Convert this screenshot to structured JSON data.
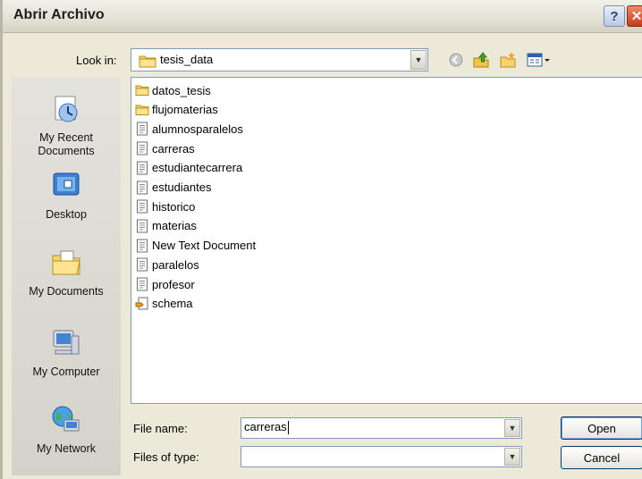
{
  "window": {
    "title": "Abrir Archivo",
    "help_glyph": "?",
    "close_glyph": "✕"
  },
  "lookin": {
    "label": "Look in:",
    "value": "tesis_data"
  },
  "toolbar": {
    "icons": [
      "back-icon",
      "up-folder-icon",
      "new-folder-icon",
      "views-menu-icon"
    ]
  },
  "places": [
    {
      "label": "My Recent\nDocuments",
      "icon": "recent-documents-icon"
    },
    {
      "label": "Desktop",
      "icon": "desktop-icon"
    },
    {
      "label": "My Documents",
      "icon": "my-documents-icon"
    },
    {
      "label": "My Computer",
      "icon": "my-computer-icon"
    },
    {
      "label": "My Network",
      "icon": "my-network-icon"
    }
  ],
  "files": [
    {
      "name": "datos_tesis",
      "type": "folder"
    },
    {
      "name": "flujomaterias",
      "type": "folder"
    },
    {
      "name": "alumnosparalelos",
      "type": "text"
    },
    {
      "name": "carreras",
      "type": "text"
    },
    {
      "name": "estudiantecarrera",
      "type": "text"
    },
    {
      "name": "estudiantes",
      "type": "text"
    },
    {
      "name": "historico",
      "type": "text"
    },
    {
      "name": "materias",
      "type": "text"
    },
    {
      "name": "New Text Document",
      "type": "text"
    },
    {
      "name": "paralelos",
      "type": "text"
    },
    {
      "name": "profesor",
      "type": "text"
    },
    {
      "name": "schema",
      "type": "schema"
    }
  ],
  "filename": {
    "label": "File name:",
    "value": "carreras"
  },
  "filetype": {
    "label": "Files of type:",
    "value": ""
  },
  "buttons": {
    "open": "Open",
    "cancel": "Cancel"
  }
}
